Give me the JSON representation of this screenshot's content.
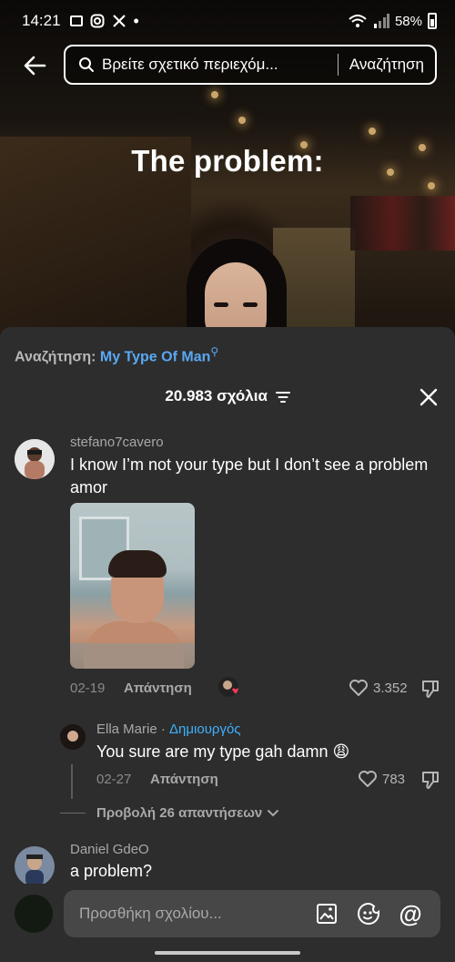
{
  "status_bar": {
    "time": "14:21",
    "battery": "58%"
  },
  "search": {
    "query": "Βρείτε σχετικό περιεχόμ...",
    "submit_label": "Αναζήτηση"
  },
  "video": {
    "overlay_text": "The problem:"
  },
  "comments_sheet": {
    "search_prefix": "Αναζήτηση:",
    "search_term": "My Type Of Man",
    "comment_count_label": "20.983 σχόλια",
    "comments": [
      {
        "username": "stefano7cavero",
        "text": "I know I’m not your type but I don’t see a problem amor",
        "date": "02-19",
        "reply_label": "Απάντηση",
        "likes": "3.352"
      },
      {
        "username": "Daniel GdeO",
        "text": "a problem?"
      }
    ],
    "reply": {
      "username": "Ella Marie",
      "separator": " · ",
      "badge": "Δημιουργός",
      "text": "You sure are my type gah damn 😩",
      "date": "02-27",
      "reply_label": "Απάντηση",
      "likes": "783"
    },
    "view_replies_label": "Προβολή 26 απαντήσεων"
  },
  "composer": {
    "placeholder": "Προσθήκη σχολίου..."
  },
  "colors": {
    "sheet_bg": "#2d2d2d",
    "link_blue": "#5aa8f5",
    "creator_blue": "#3fb0ff"
  }
}
